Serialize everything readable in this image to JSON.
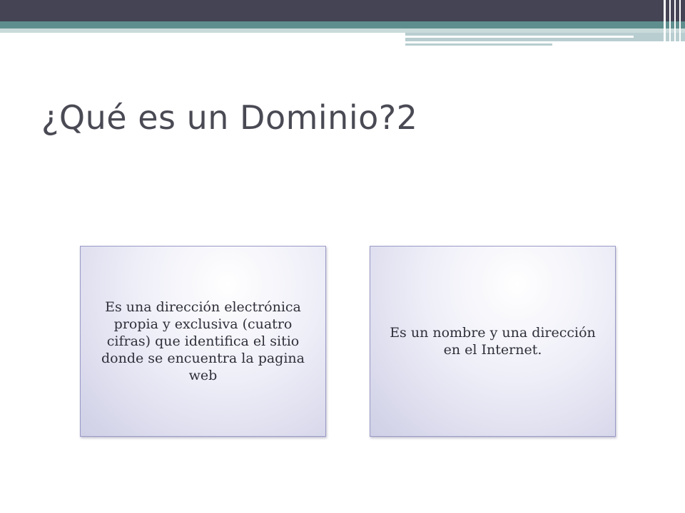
{
  "slide": {
    "title": "¿Qué es un Dominio?2",
    "boxes": [
      {
        "text": "Es una dirección electrónica propia y exclusiva (cuatro cifras) que identifica el sitio donde se encuentra la pagina web"
      },
      {
        "text": "Es un nombre y una dirección en el Internet."
      }
    ]
  },
  "theme": {
    "header_dark": "#444455",
    "header_teal": "#5e8f8e",
    "title_color": "#4a4a55",
    "box_border": "#9a9ac8"
  }
}
